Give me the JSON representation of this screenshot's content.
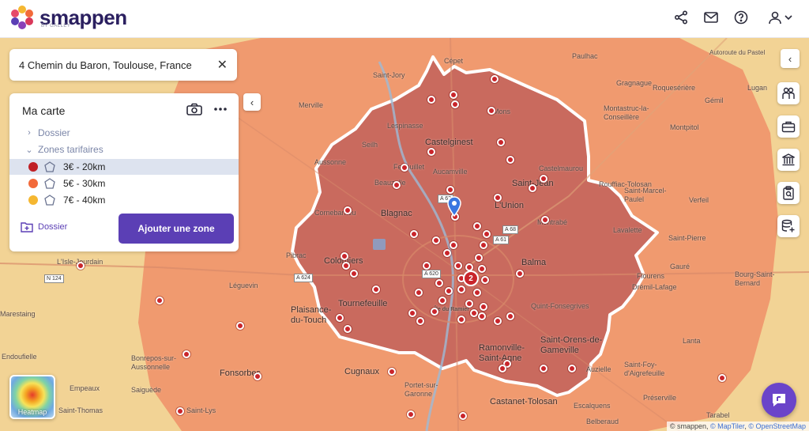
{
  "app": {
    "brand": "smappen",
    "brand_sub": "BY GALLEY"
  },
  "header": {
    "icons": [
      "share-icon",
      "mail-icon",
      "help-icon",
      "user-icon",
      "chevron-down-icon"
    ]
  },
  "search": {
    "address": "4 Chemin du Baron, Toulouse, France"
  },
  "panel": {
    "title": "Ma carte",
    "tree": [
      {
        "label": "Dossier",
        "expanded": false
      },
      {
        "label": "Zones tarifaires",
        "expanded": true
      }
    ],
    "zones": [
      {
        "label": "3€ - 20km",
        "color": "#c01f25",
        "active": true
      },
      {
        "label": "5€ - 30km",
        "color": "#f26a3a",
        "active": false
      },
      {
        "label": "7€ - 40km",
        "color": "#f5b731",
        "active": false
      }
    ],
    "folder_button": "Dossier",
    "add_zone_button": "Ajouter une zone"
  },
  "map": {
    "cluster_count": "2",
    "heatmap_label": "Heatmap",
    "attribution_prefix": "© smappen,",
    "attribution_maptiler": "© MapTiler",
    "attribution_osm": "© OpenStreetMap",
    "colors": {
      "zone_outer": "#f5c56e",
      "zone_mid": "#f08a5a",
      "zone_inner": "#d25c55",
      "poi": "#c9252b",
      "brand": "#5b3fb5"
    },
    "places": [
      "Saint-Jory",
      "Cépet",
      "Paulhac",
      "Autoroute du Pastel",
      "Merville",
      "Lespinasse",
      "Gragnague",
      "Roquesérière",
      "Lugan",
      "Montastruc-la-Conseillère",
      "Gémil",
      "Montpitol",
      "Seilh",
      "Castelginest",
      "Mons",
      "Aussonne",
      "Fenouillet",
      "Aucamville",
      "Castelmaurou",
      "Beauzelle",
      "Saint-Jean",
      "Rouffiac-Tolosan",
      "Saint-Marcel-Paulel",
      "Verfeil",
      "Cornebarrieu",
      "Blagnac",
      "L'Union",
      "Montrabé",
      "Lavalette",
      "Saint-Pierre",
      "Pibrac",
      "Colomiers",
      "Balma",
      "Gauré",
      "Bourg-Saint-Bernard",
      "L'Isle-Jourdain",
      "Léguevin",
      "Flourens",
      "Drémil-Lafage",
      "Tournefeuille",
      "Quint-Fonsegrives",
      "Plaisance-du-Touch",
      "Marestaing",
      "Saint-Orens-de-Gameville",
      "Lanta",
      "Ramonville-Saint-Agne",
      "Endoufielle",
      "Bonrepos-sur-Aussonnelle",
      "Fonsorbes",
      "Cugnaux",
      "Auzielle",
      "Saint-Foy-d'Aigrefeuille",
      "Empeaux",
      "Saiguède",
      "Portet-sur-Garonne",
      "Préserville",
      "Saint-Thomas",
      "Saint-Lys",
      "Castanet-Tolosan",
      "Escalquens",
      "Belberaud",
      "Tarabel",
      "Île du Ramier"
    ],
    "roads": [
      "A 62",
      "A 68",
      "A 61",
      "A 620",
      "A 624",
      "N 124"
    ]
  }
}
